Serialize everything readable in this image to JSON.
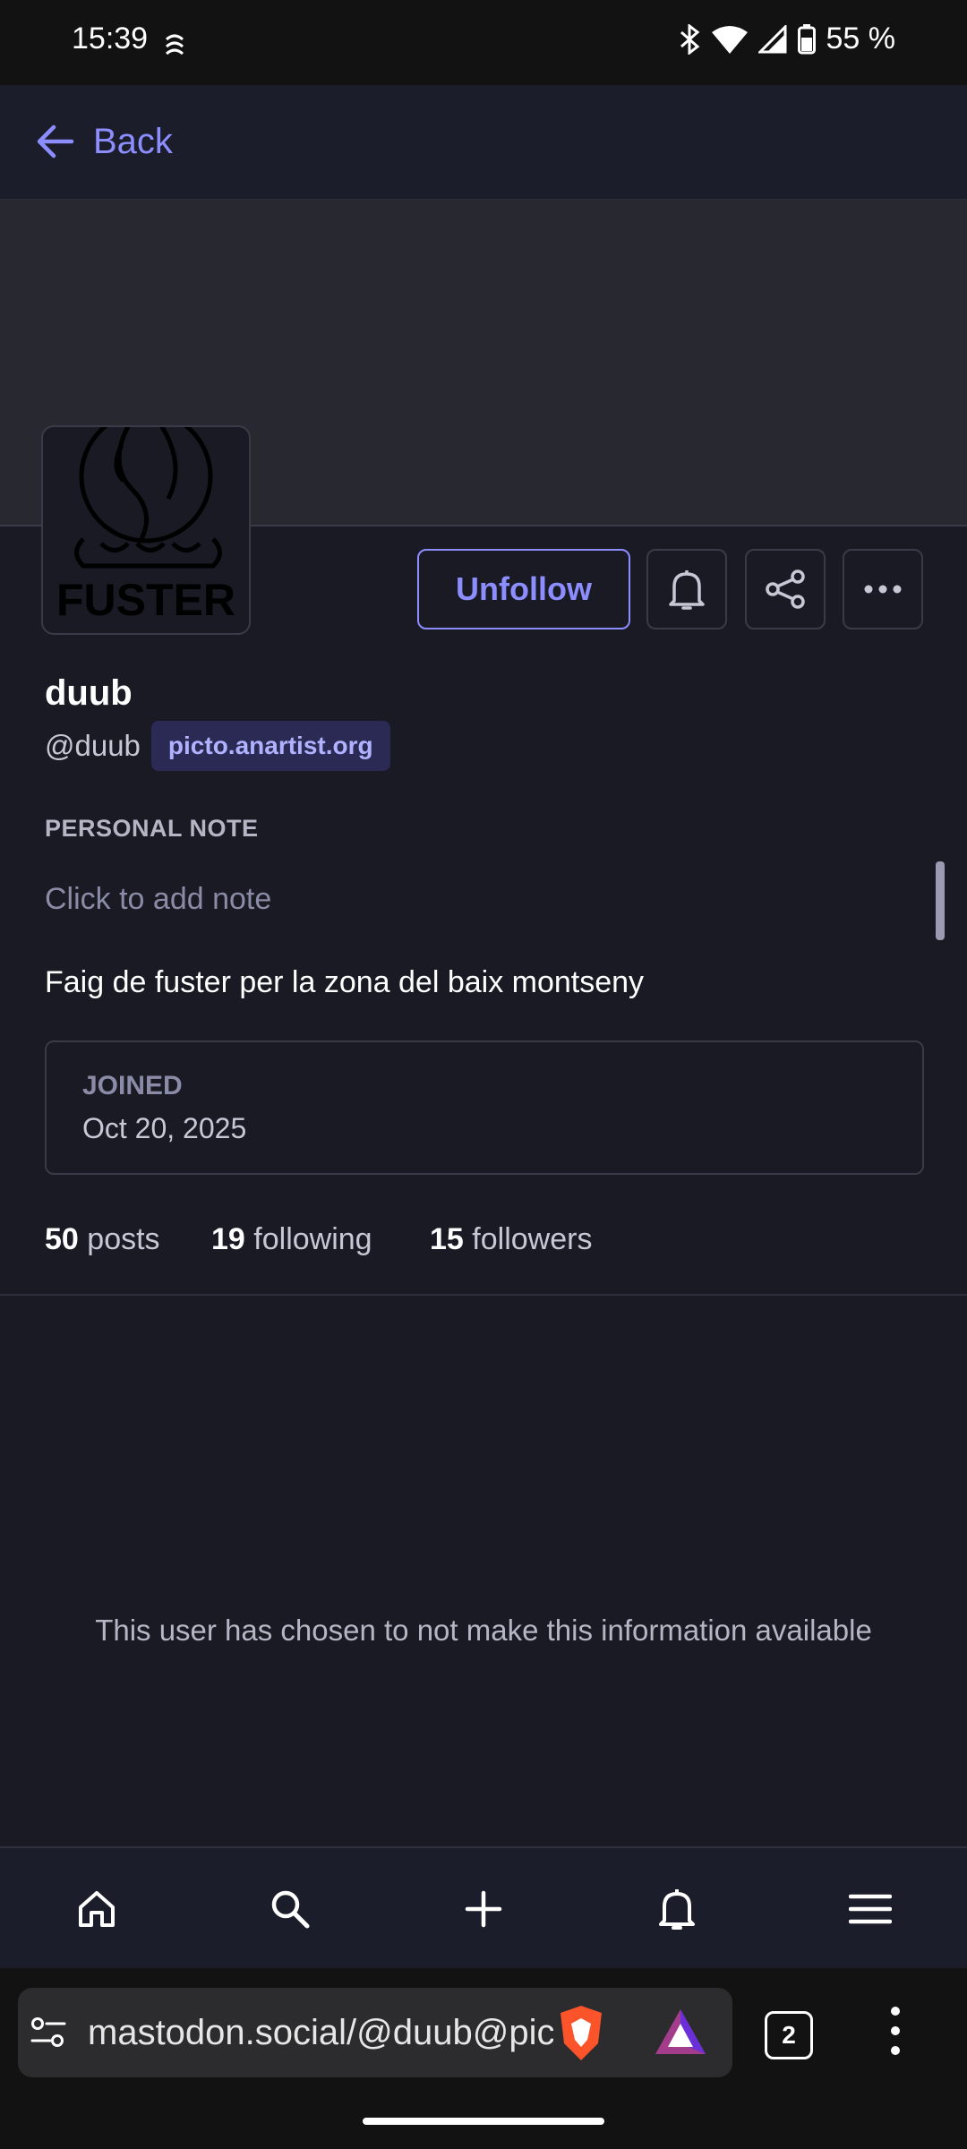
{
  "status_bar": {
    "time": "15:39",
    "battery": "55 %"
  },
  "nav": {
    "back_label": "Back"
  },
  "profile": {
    "display_name": "duub",
    "handle": "@duub",
    "domain": "picto.anartist.org",
    "avatar_text": "FUSTER",
    "unfollow_label": "Unfollow",
    "personal_note_label": "PERSONAL NOTE",
    "note_placeholder": "Click to add note",
    "bio": "Faig de fuster per la zona del baix montseny",
    "joined_label": "JOINED",
    "joined_date": "Oct 20, 2025"
  },
  "stats": {
    "posts_count": "50",
    "posts_label": "posts",
    "following_count": "19",
    "following_label": "following",
    "followers_count": "15",
    "followers_label": "followers"
  },
  "hidden_message": "This user has chosen to not make this information available",
  "browser": {
    "url": "mastodon.social/@duub@picto.anartist.org",
    "tab_count": "2"
  },
  "colors": {
    "accent": "#8c8dff",
    "background": "#191a23",
    "banner": "#282831"
  }
}
